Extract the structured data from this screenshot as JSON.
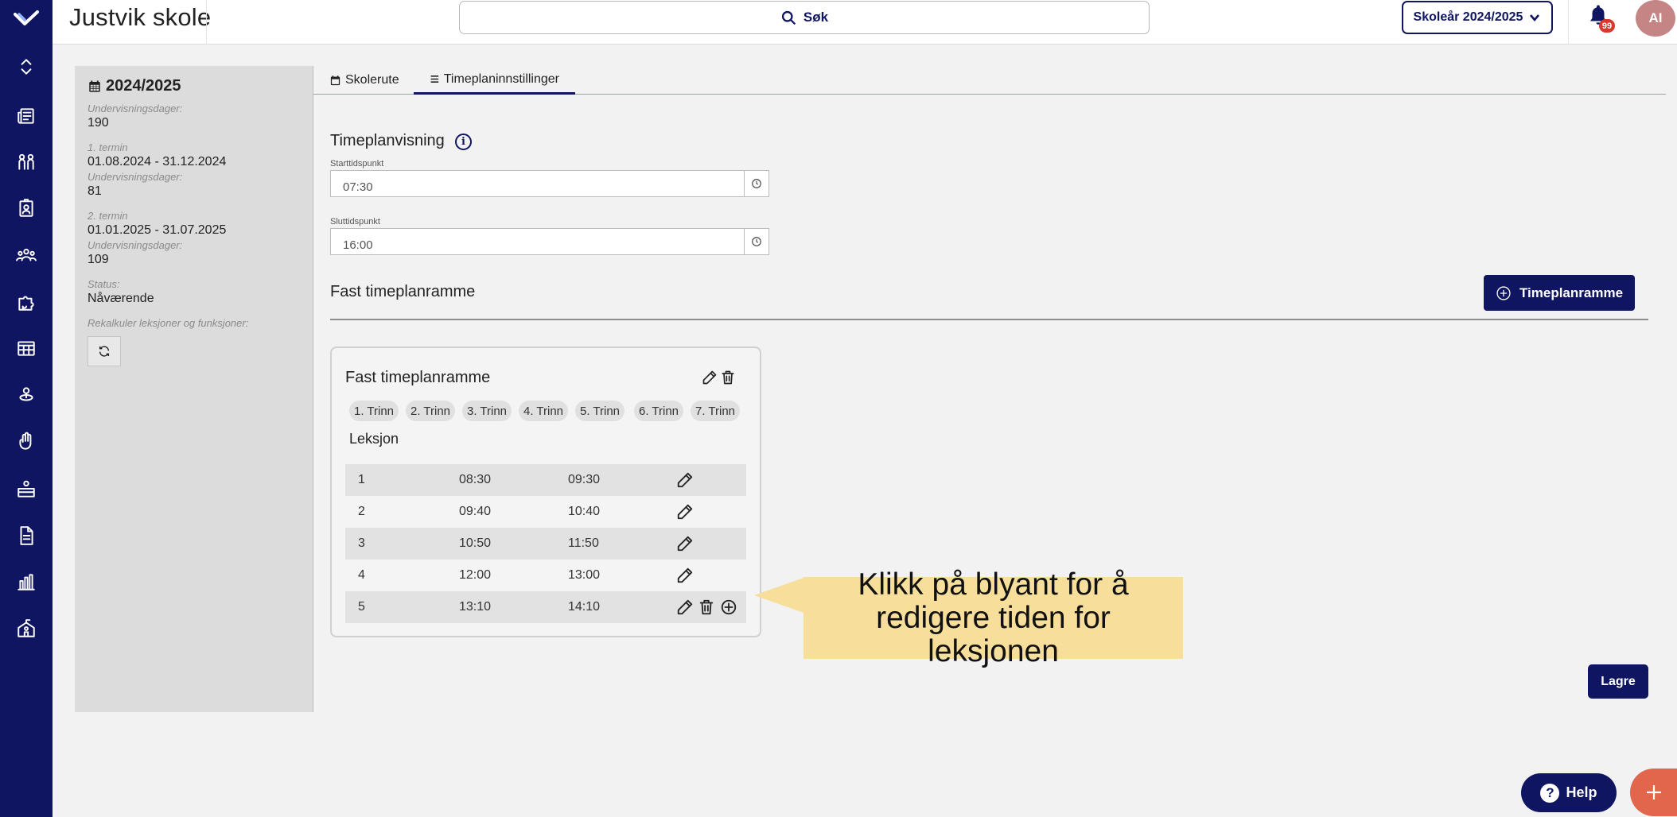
{
  "app": {
    "school_name": "Justvik skole",
    "search_label": "Søk",
    "year_selector": "Skoleår 2024/2025",
    "notification_count": "99",
    "avatar_initials": "AI"
  },
  "nav_icons": [
    "logo-icon",
    "expand-icon",
    "newspaper-icon",
    "people-icon",
    "badge-icon",
    "group-icon",
    "puzzle-icon",
    "calendar-grid-icon",
    "person-pin-icon",
    "hand-icon",
    "desk-icon",
    "document-icon",
    "chart-icon",
    "school-icon"
  ],
  "info_panel": {
    "year": "2024/2025",
    "days_label": "Undervisningsdager:",
    "days_value": "190",
    "term1_label": "1. termin",
    "term1_range": "01.08.2024 - 31.12.2024",
    "term1_days_label": "Undervisningsdager:",
    "term1_days": "81",
    "term2_label": "2. termin",
    "term2_range": "01.01.2025 - 31.07.2025",
    "term2_days_label": "Undervisningsdager:",
    "term2_days": "109",
    "status_label": "Status:",
    "status_value": "Nåværende",
    "recalc_label": "Rekalkuler leksjoner og funksjoner:"
  },
  "tabs": [
    {
      "label": "Skolerute",
      "icon": "calendar-icon"
    },
    {
      "label": "Timeplaninnstillinger",
      "icon": "list-icon",
      "active": true
    }
  ],
  "view_settings": {
    "title": "Timeplanvisning",
    "start_label": "Starttidspunkt",
    "start_value": "07:30",
    "end_label": "Sluttidspunkt",
    "end_value": "16:00"
  },
  "fixed_frame": {
    "section_title": "Fast timeplanramme",
    "add_button": "Timeplanramme",
    "card_title": "Fast timeplanramme",
    "grades": [
      "1. Trinn",
      "2. Trinn",
      "3. Trinn",
      "4. Trinn",
      "5. Trinn",
      "6. Trinn",
      "7. Trinn"
    ],
    "lessons_heading": "Leksjon",
    "lessons": [
      {
        "nr": "1",
        "start": "08:30",
        "end": "09:30"
      },
      {
        "nr": "2",
        "start": "09:40",
        "end": "10:40"
      },
      {
        "nr": "3",
        "start": "10:50",
        "end": "11:50"
      },
      {
        "nr": "4",
        "start": "12:00",
        "end": "13:00"
      },
      {
        "nr": "5",
        "start": "13:10",
        "end": "14:10"
      }
    ]
  },
  "tooltip": "Klikk på blyant for å redigere tiden for leksjonen",
  "save_button": "Lagre",
  "help_button": "Help",
  "colors": {
    "brand": "#0f1560",
    "tooltip": "#f8de9b",
    "fab": "#e2664b",
    "badge": "#d73a2c"
  }
}
